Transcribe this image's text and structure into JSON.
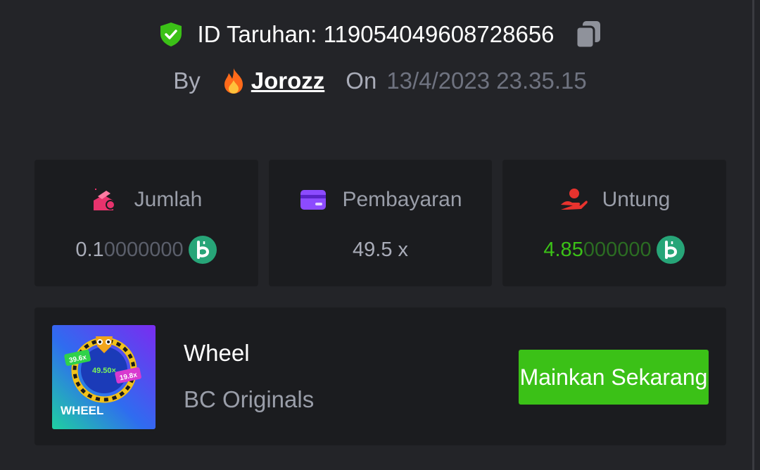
{
  "bet": {
    "id_label": "ID Taruhan: 1190540496087286​56",
    "by_label": "By",
    "username": "Jorozz",
    "on_label": "On",
    "timestamp": "13/4/2023 23.35.15"
  },
  "stats": {
    "amount": {
      "label": "Jumlah",
      "value_main": "0.1",
      "value_dim": "0000000"
    },
    "payout": {
      "label": "Pembayaran",
      "value": "49.5 x"
    },
    "profit": {
      "label": "Untung",
      "value_main": "4.85",
      "value_dim": "000000"
    }
  },
  "game": {
    "name": "Wheel",
    "provider": "BC Originals",
    "play_label": "Mainkan Sekarang",
    "thumb": {
      "title": "WHEEL",
      "center_label": "49.50×",
      "left_label": "39.6x",
      "right_label": "19.8x"
    }
  },
  "colors": {
    "background": "#232428",
    "card": "#1b1c1f",
    "accent_green": "#3bc117",
    "coin": "#27a578"
  }
}
